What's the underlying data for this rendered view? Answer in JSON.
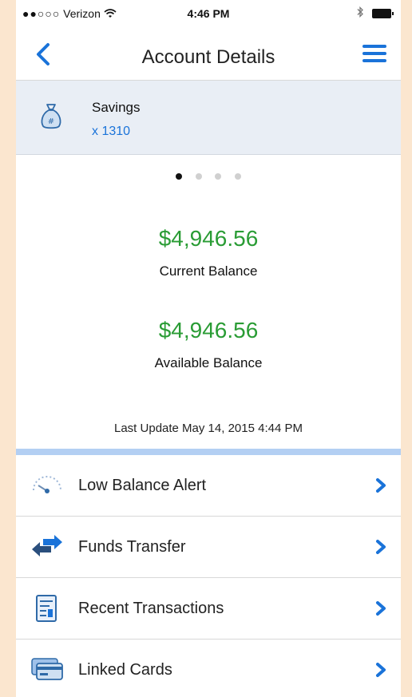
{
  "status_bar": {
    "carrier": "Verizon",
    "signal_dots": "●●○○○",
    "time": "4:46 PM"
  },
  "nav": {
    "title": "Account Details"
  },
  "account": {
    "name": "Savings",
    "number": "x 1310"
  },
  "pager": {
    "count": 4,
    "active_index": 0
  },
  "balances": {
    "current_amount": "$4,946.56",
    "current_label": "Current Balance",
    "available_amount": "$4,946.56",
    "available_label": "Available Balance"
  },
  "last_update": "Last Update May 14, 2015 4:44 PM",
  "menu": [
    {
      "label": "Low Balance Alert",
      "icon": "gauge-icon"
    },
    {
      "label": "Funds Transfer",
      "icon": "transfer-arrows-icon"
    },
    {
      "label": "Recent Transactions",
      "icon": "receipt-icon"
    },
    {
      "label": "Linked Cards",
      "icon": "card-icon"
    }
  ],
  "colors": {
    "accent_blue": "#1a73d9",
    "balance_green": "#2a9c35",
    "account_bg": "#e9eef5",
    "divider_blue": "#b3cff3"
  }
}
